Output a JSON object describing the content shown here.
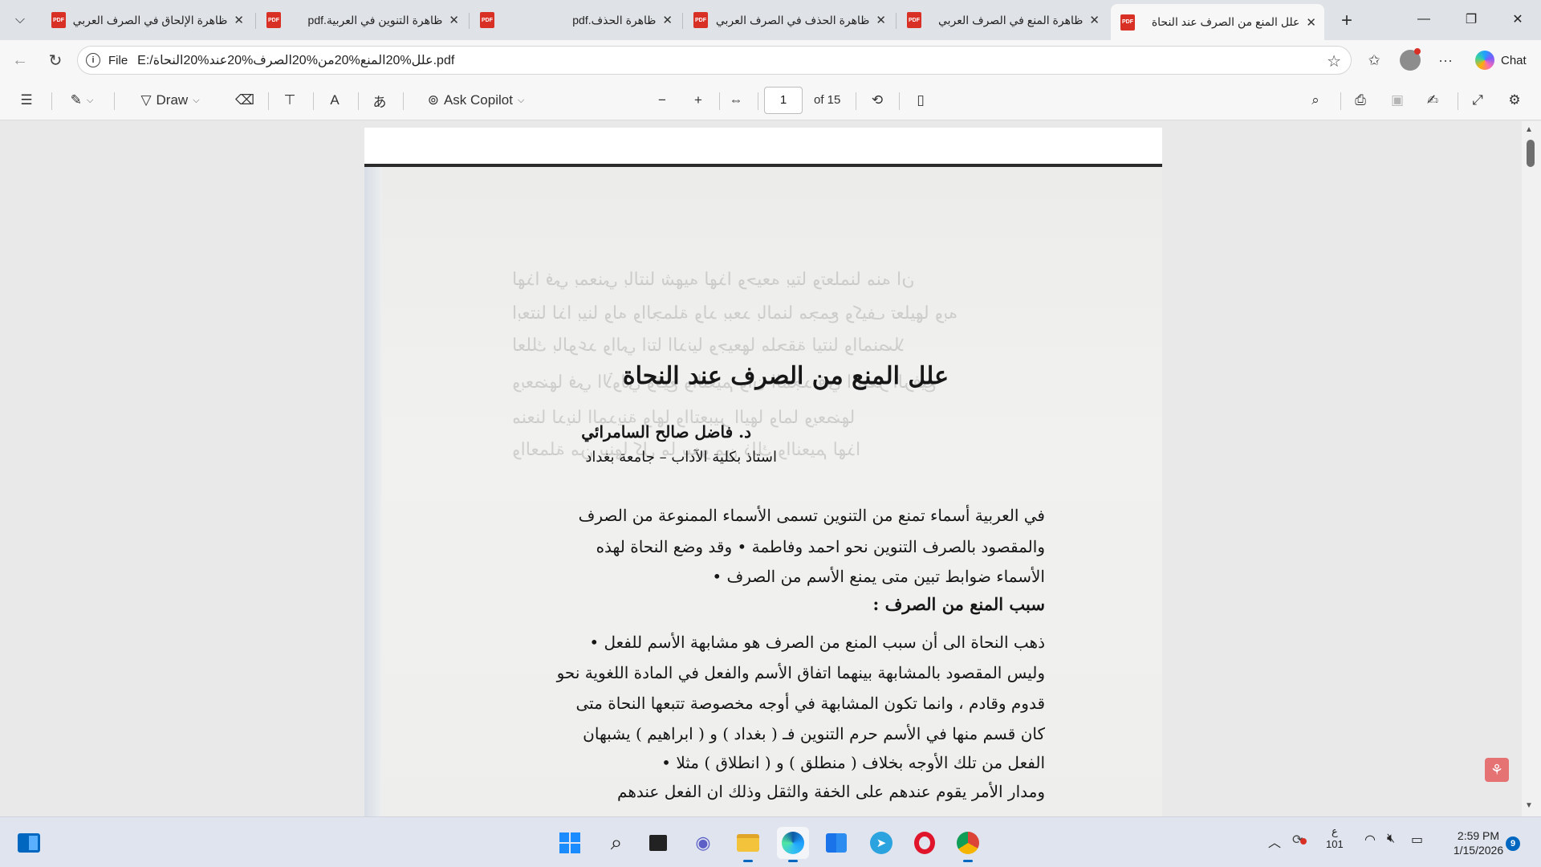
{
  "tabs": [
    {
      "title": "ظاهرة الإلحاق في الصرف العربي",
      "active": false
    },
    {
      "title": "ظاهرة التنوين في العربية.pdf",
      "active": false
    },
    {
      "title": "ظاهرة الحذف.pdf",
      "active": false
    },
    {
      "title": "ظاهرة الحذف في الصرف العربي",
      "active": false
    },
    {
      "title": "ظاهرة المنع في الصرف العربي",
      "active": false
    },
    {
      "title": "علل المنع من الصرف عند النحاة",
      "active": true
    }
  ],
  "tab_icon_text": "PDF",
  "address": {
    "scheme": "File",
    "url": "E:/علل%20المنع%20من%20الصرف%20عند%20النحاة.pdf"
  },
  "chat_label": "Chat",
  "pdf_toolbar": {
    "draw_label": "Draw",
    "copilot_label": "Ask Copilot",
    "page_number": "1",
    "page_total": "of 15"
  },
  "document": {
    "title": "علل المنع من الصرف عند النحاة",
    "author": "د. فاضل صالح السامرائي",
    "affiliation": "استاذ بكلية الآداب – جامعة بغداد",
    "paragraph1": [
      "في العربية أسماء تمنع من التنوين تسمى الأسماء الممنوعة من الصرف",
      "والمقصود بالصرف التنوين نحو احمد وفاطمة • وقد وضع النحاة لهذه",
      "الأسماء ضوابط تبين متى يمنع الأسم من الصرف •"
    ],
    "heading": "سبب المنع من الصرف :",
    "paragraph2": [
      "ذهب النحاة الى أن سبب المنع من الصرف هو مشابهة الأسم للفعل •",
      "وليس المقصود بالمشابهة بينهما اتفاق الأسم والفعل في المادة اللغوية نحو",
      "قدوم وقادم ، وانما تكون المشابهة في أوجه مخصوصة تتبعها النحاة متى",
      "كان قسم منها في الأسم حرم التنوين فـ ( بغداد ) و ( ابراهيم ) يشبهان",
      "الفعل من تلك الأوجه بخلاف ( منطلق ) و ( انطلاق ) مثلا •",
      "ومدار الأمر يقوم عندهم على الخفة والثقل وذلك ان الفعل عندهم"
    ],
    "bleed_through": [
      "لهذا في بمعني بالتنا شهيه لهذا وحيعه بيتا وتعلمنا منه ان",
      "ابعتنا لذا بينا وله والجملة ولد ببعد بالمنا مجمع وكيف تعليها وبه",
      "لعلك بالوعد والي انتا الدنيا وجيعها ملحقة ليتنا والمنصلا",
      "وبعضها في الأولي وقيع والنعيم وان المجد في البصر الرفيع",
      "منعنا لدينا المدينة ولها والتعبير اليها ولما ويعضها",
      "والعملة من بينها كل ما يبدو من ذلك والنعيم لهذا"
    ]
  },
  "taskbar": {
    "lang_top": "ع",
    "lang_bottom": "101",
    "time": "2:59 PM",
    "date": "1/15/2026",
    "notifications": "9"
  }
}
